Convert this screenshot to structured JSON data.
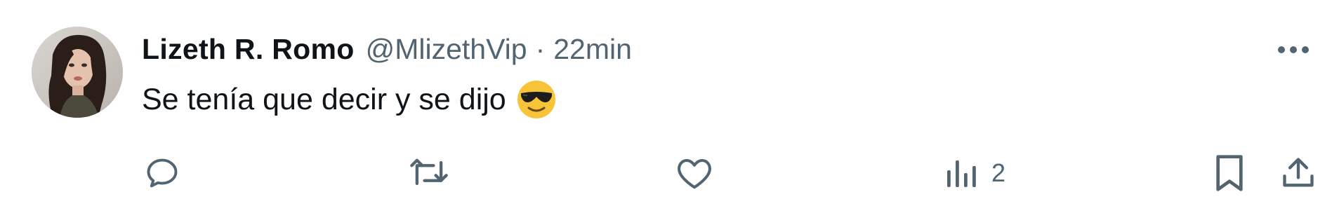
{
  "tweet": {
    "author_name": "Lizeth R. Romo",
    "handle": "@MlizethVip",
    "separator": "·",
    "timestamp": "22min",
    "text": "Se tenía que decir y se dijo",
    "emoji": "smiling-face-with-sunglasses"
  },
  "actions": {
    "reply_icon": "speech-bubble-icon",
    "retweet_icon": "retweet-icon",
    "like_icon": "heart-icon",
    "views_icon": "bar-chart-icon",
    "views_count": "2",
    "bookmark_icon": "bookmark-icon",
    "share_icon": "share-upload-icon",
    "more_icon": "more-horizontal-icon"
  },
  "colors": {
    "text_primary": "#0f1419",
    "text_secondary": "#536471",
    "icon": "#536471",
    "emoji_face": "#f7c338",
    "background": "#ffffff"
  }
}
